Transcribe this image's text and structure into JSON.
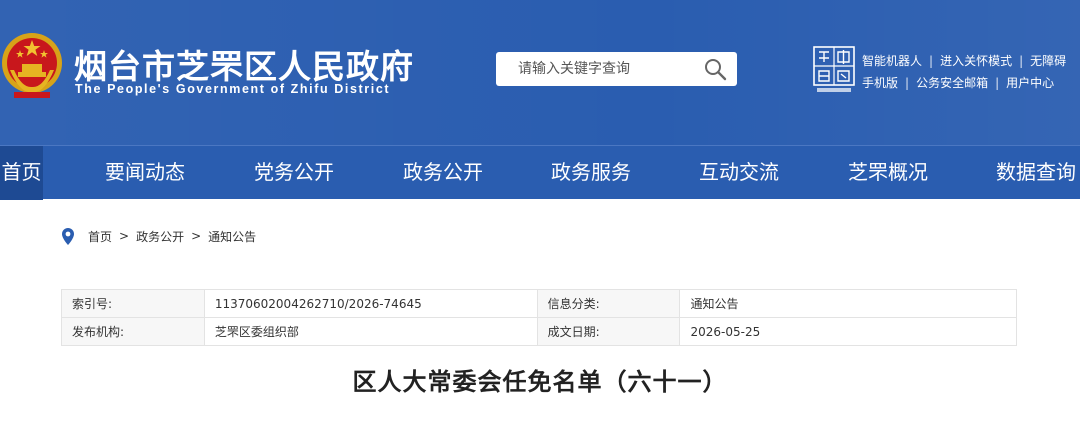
{
  "header": {
    "site_title": "烟台市芝罘区人民政府",
    "site_subtitle": "The People's Government of Zhifu District",
    "background_color": "#2a5db0",
    "emblem_icon": "national-emblem-icon",
    "search": {
      "placeholder": "请输入关键字查询",
      "button_icon": "search-icon"
    },
    "yantai_logo_icon": "yantai-china-logo-icon",
    "top_links": {
      "row1": [
        "智能机器人",
        "进入关怀模式",
        "无障碍"
      ],
      "row2": [
        "手机版",
        "公务安全邮箱",
        "用户中心"
      ]
    }
  },
  "nav": {
    "items": [
      "首页",
      "要闻动态",
      "党务公开",
      "政务公开",
      "政务服务",
      "互动交流",
      "芝罘概况",
      "数据查询"
    ],
    "active_index": 0,
    "active_color": "#1e4a93"
  },
  "breadcrumb": {
    "icon": "location-pin-icon",
    "items": [
      "首页",
      "政务公开",
      "通知公告"
    ],
    "separator": ">"
  },
  "info_table": {
    "rows": [
      [
        {
          "label": "索引号:",
          "value": "11370602004262710/2026-74645"
        },
        {
          "label": "信息分类:",
          "value": "通知公告"
        }
      ],
      [
        {
          "label": "发布机构:",
          "value": "芝罘区委组织部"
        },
        {
          "label": "成文日期:",
          "value": "2026-05-25"
        }
      ]
    ]
  },
  "article": {
    "title": "区人大常委会任免名单（六十一）"
  }
}
